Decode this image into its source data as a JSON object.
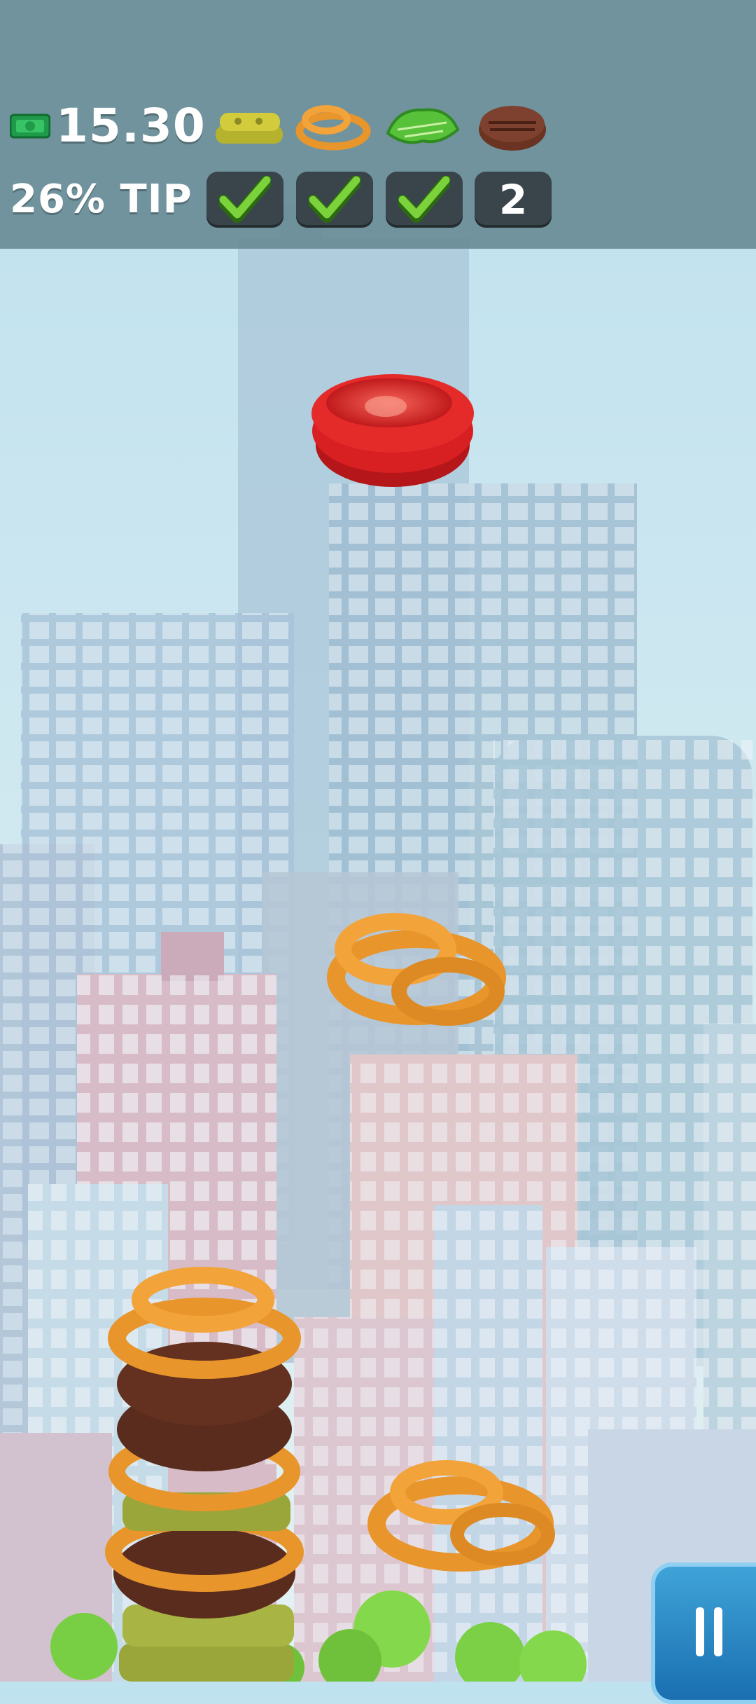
{
  "hud": {
    "money": "15.30",
    "tip": "26% TIP",
    "order_ingredients": [
      "pickles",
      "onion-rings",
      "lettuce",
      "beef-patty"
    ],
    "order_status": [
      {
        "ingredient": "pickles",
        "state": "done"
      },
      {
        "ingredient": "onion-rings",
        "state": "done"
      },
      {
        "ingredient": "lettuce",
        "state": "done"
      },
      {
        "ingredient": "beef-patty",
        "state": "remaining",
        "count": "2"
      }
    ]
  },
  "falling_items": [
    "tomato-slices",
    "onion-rings",
    "onion-rings"
  ],
  "burger_stack_layers": [
    "pickles",
    "beef-patty",
    "onion-rings",
    "pickles",
    "onion-rings",
    "beef-patty",
    "beef-patty",
    "onion-rings",
    "onion-rings"
  ],
  "colors": {
    "hud_bg": "#698c96",
    "check_green": "#7bd23a",
    "slot_dark": "#39454a",
    "onion_ring": "#e8952b",
    "patty": "#5a2c1d",
    "pickle": "#9aa63a",
    "tomato": "#e0282a"
  }
}
